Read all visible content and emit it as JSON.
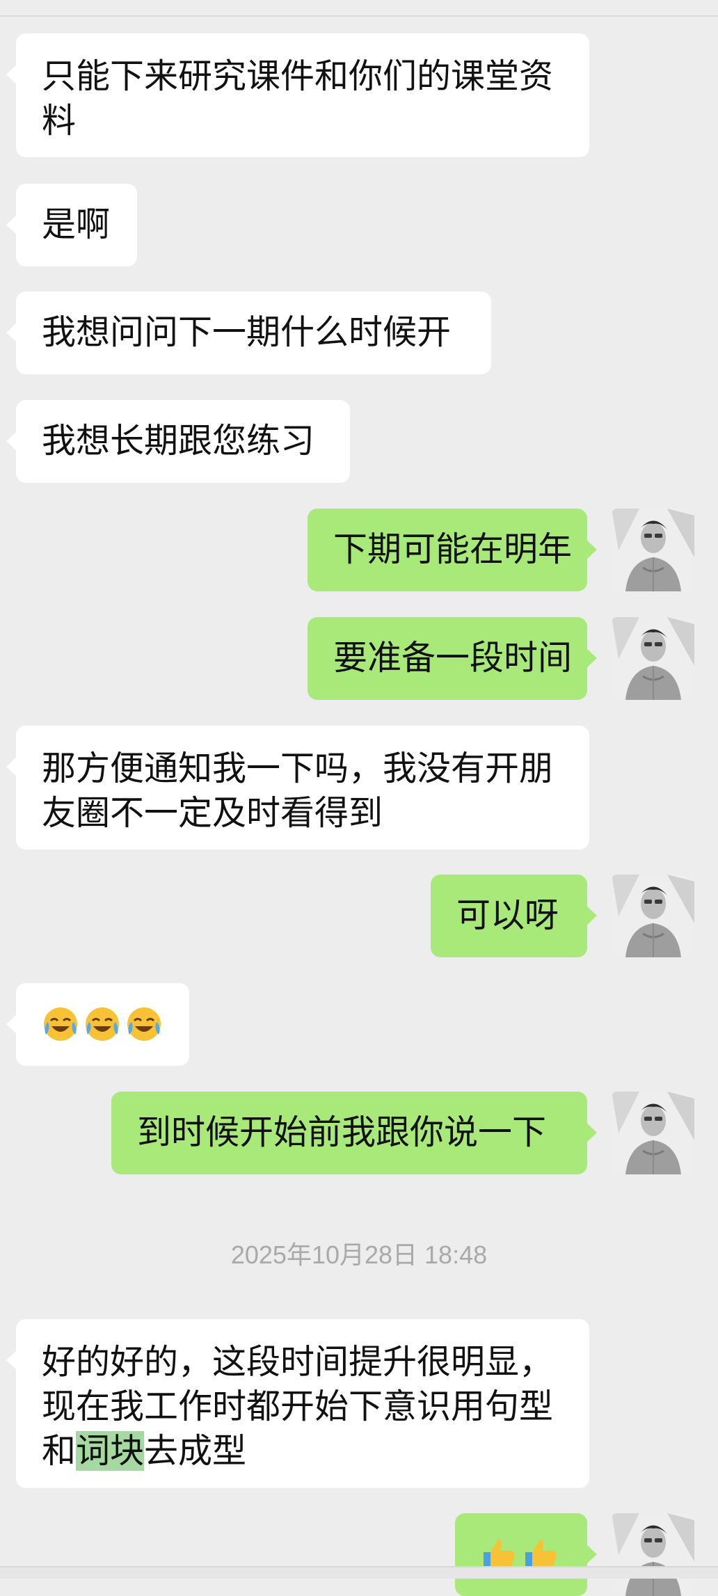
{
  "messages": [
    {
      "side": "in",
      "text": "只能下来研究课件和你们的课堂资料"
    },
    {
      "side": "in",
      "text": "是啊"
    },
    {
      "side": "in",
      "text": "我想问问下一期什么时候开"
    },
    {
      "side": "in",
      "text": "我想长期跟您练习"
    },
    {
      "side": "out",
      "text": "下期可能在明年"
    },
    {
      "side": "out",
      "text": "要准备一段时间"
    },
    {
      "side": "in",
      "text": "那方便通知我一下吗，我没有开朋友圈不一定及时看得到"
    },
    {
      "side": "out",
      "text": "可以呀"
    },
    {
      "side": "in",
      "emoji": "loudly-laughing-face",
      "emoji_count": 3
    },
    {
      "side": "out",
      "text": "到时候开始前我跟你说一下"
    },
    {
      "side": "in",
      "text_before": "好的好的，这段时间提升很明显，现在我工作时都开始下意识用句型和",
      "highlight": "词块",
      "text_after": "去成型"
    },
    {
      "side": "out",
      "emoji": "thumbs-up",
      "emoji_count": 2
    }
  ],
  "timestamp": "2025年10月28日 18:48",
  "colors": {
    "background": "#ededed",
    "incoming_bubble": "#ffffff",
    "outgoing_bubble": "#a9e97a",
    "timestamp_text": "#a9a9a9"
  }
}
